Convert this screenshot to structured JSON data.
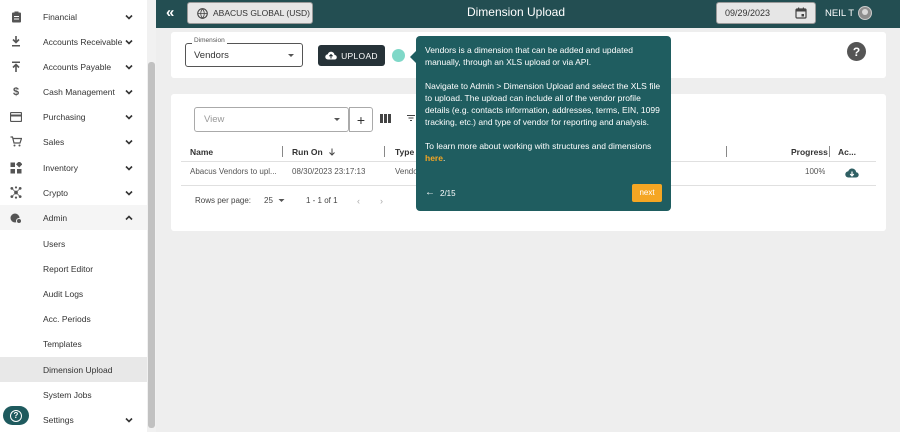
{
  "sidebar": {
    "items": [
      {
        "label": "Financial",
        "icon": "clipboard-icon"
      },
      {
        "label": "Accounts Receivable",
        "icon": "arrow-down-bar-icon"
      },
      {
        "label": "Accounts Payable",
        "icon": "arrow-up-bar-icon"
      },
      {
        "label": "Cash Management",
        "icon": "dollar-icon"
      },
      {
        "label": "Purchasing",
        "icon": "credit-card-icon"
      },
      {
        "label": "Sales",
        "icon": "cart-icon"
      },
      {
        "label": "Inventory",
        "icon": "widgets-icon"
      },
      {
        "label": "Crypto",
        "icon": "hub-icon"
      },
      {
        "label": "Admin",
        "icon": "admin-gear-icon"
      }
    ],
    "admin_sub": [
      "Users",
      "Report Editor",
      "Audit Logs",
      "Acc. Periods",
      "Templates",
      "Dimension Upload",
      "System Jobs"
    ],
    "settings": {
      "label": "Settings",
      "icon": "settings-icon"
    }
  },
  "header": {
    "entity": "ABACUS GLOBAL (USD)",
    "title": "Dimension Upload",
    "date": "09/29/2023",
    "user": "NEIL T"
  },
  "upload_card": {
    "dimension_legend": "Dimension",
    "dimension_value": "Vendors",
    "upload_label": "UPLOAD"
  },
  "table": {
    "view_placeholder": "View",
    "columns": [
      "Name",
      "Run On",
      "Type",
      "Progress",
      "Ac..."
    ],
    "rows": [
      {
        "name": "Abacus Vendors to upl...",
        "run_on": "08/30/2023 23:17:13",
        "type": "Vendo",
        "progress": "100%"
      }
    ],
    "pager": {
      "rows_per_page_label": "Rows per page:",
      "rows_per_page": "25",
      "range": "1 - 1 of 1"
    }
  },
  "tour": {
    "p1": "Vendors is a dimension that can be added and updated manually, through an XLS upload or via API.",
    "p2": "Navigate to Admin > Dimension Upload and select the XLS file to upload. The upload can include all of the vendor profile details (e.g. contacts information, addresses, terms, EIN, 1099 tracking, etc.) and type of vendor for reporting and analysis.",
    "p3_prefix": "To learn more about working with structures and dimensions ",
    "p3_link": "here",
    "p3_suffix": ".",
    "step": "2/15",
    "next": "next"
  },
  "colors": {
    "topbar": "#234e52",
    "tour_bg": "#1f5d60",
    "accent": "#f5a623"
  }
}
